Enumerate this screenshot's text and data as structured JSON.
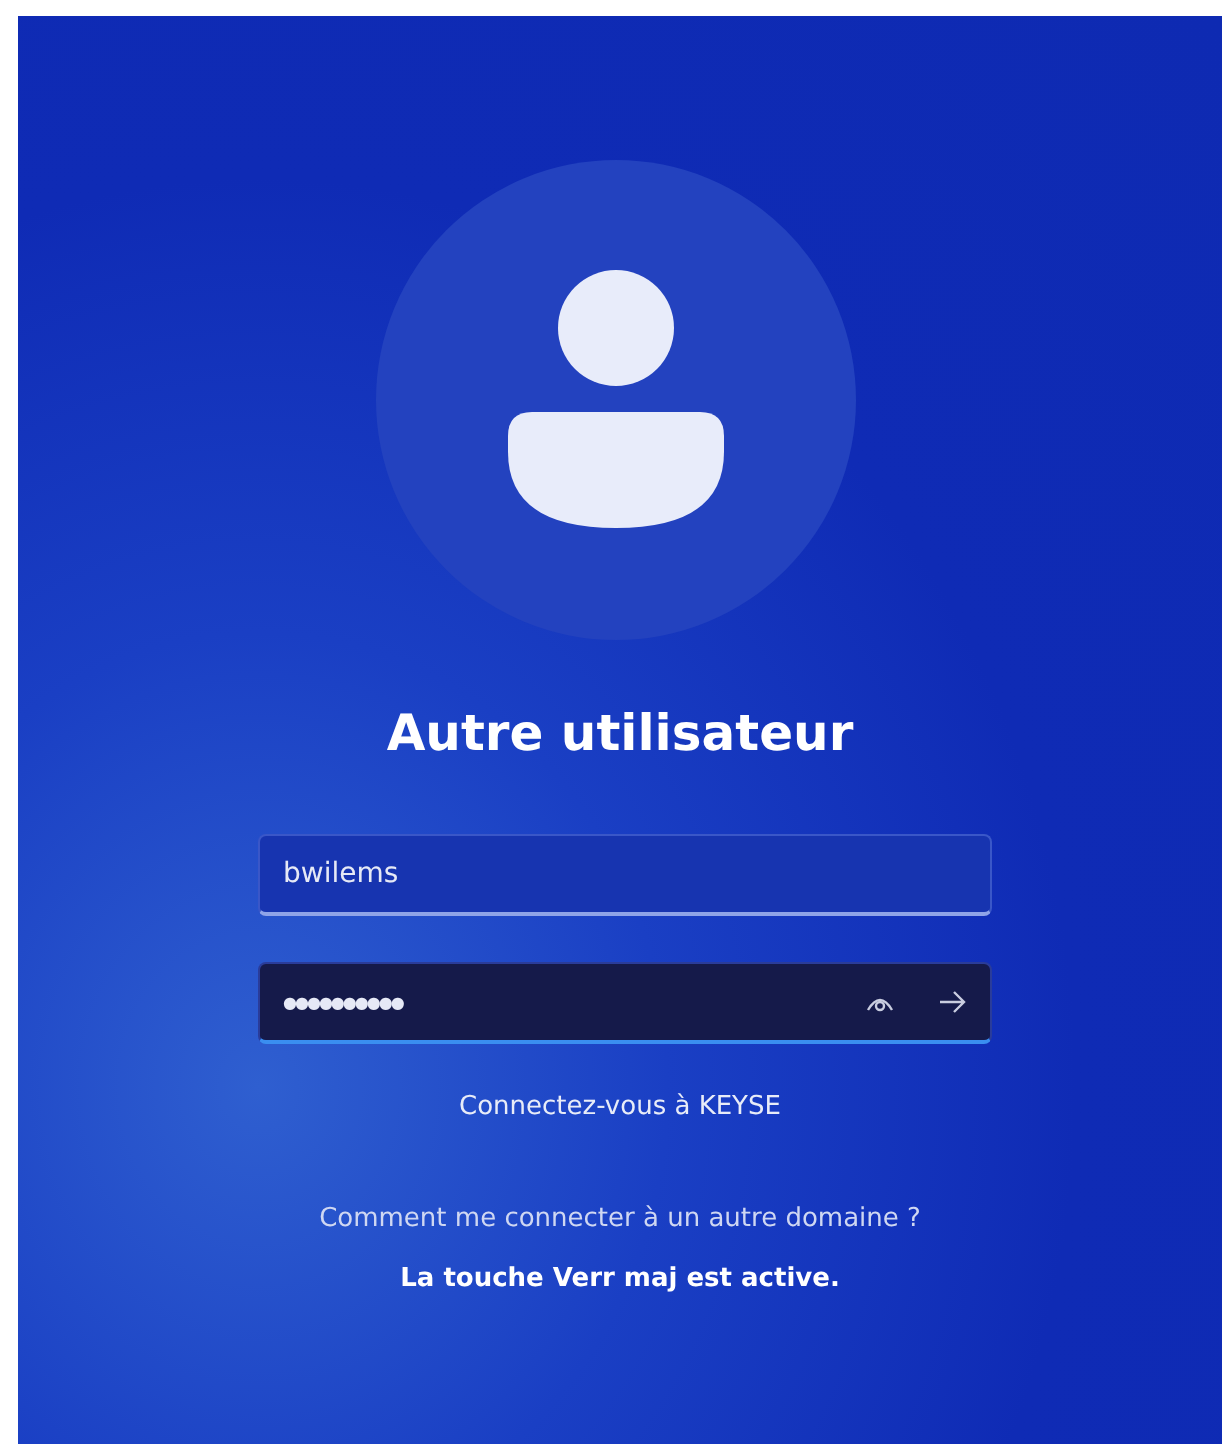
{
  "user_name": "Autre utilisateur",
  "username_field": {
    "value": "bwilems",
    "focused": false
  },
  "password_field": {
    "value": "●●●●●●●●●●",
    "focused": true
  },
  "sign_in_to": "Connectez-vous à KEYSE",
  "other_domain_link": "Comment me connecter à un autre domaine ?",
  "caps_lock_warning": "La touche Verr maj est active."
}
